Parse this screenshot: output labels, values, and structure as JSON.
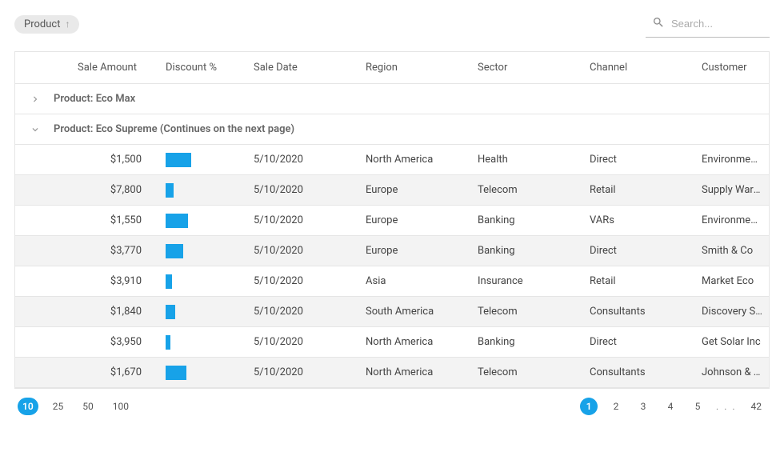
{
  "toolbar": {
    "chip_label": "Product",
    "chip_sort_icon": "arrow-up",
    "search_placeholder": "Search..."
  },
  "columns": [
    "Sale Amount",
    "Discount %",
    "Sale Date",
    "Region",
    "Sector",
    "Channel",
    "Customer"
  ],
  "groups": [
    {
      "expanded": false,
      "label": "Product: Eco Max"
    },
    {
      "expanded": true,
      "label": "Product: Eco Supreme (Continues on the next page)"
    }
  ],
  "rows": [
    {
      "amount": "$1,500",
      "discount_pct": 32,
      "date": "5/10/2020",
      "region": "North America",
      "sector": "Health",
      "channel": "Direct",
      "customer": "Environment Solar"
    },
    {
      "amount": "$7,800",
      "discount_pct": 10,
      "date": "5/10/2020",
      "region": "Europe",
      "sector": "Telecom",
      "channel": "Retail",
      "customer": "Supply Warehous"
    },
    {
      "amount": "$1,550",
      "discount_pct": 28,
      "date": "5/10/2020",
      "region": "Europe",
      "sector": "Banking",
      "channel": "VARs",
      "customer": "Environment Solar"
    },
    {
      "amount": "$3,770",
      "discount_pct": 22,
      "date": "5/10/2020",
      "region": "Europe",
      "sector": "Banking",
      "channel": "Direct",
      "customer": "Smith & Co"
    },
    {
      "amount": "$3,910",
      "discount_pct": 8,
      "date": "5/10/2020",
      "region": "Asia",
      "sector": "Insurance",
      "channel": "Retail",
      "customer": "Market Eco"
    },
    {
      "amount": "$1,840",
      "discount_pct": 12,
      "date": "5/10/2020",
      "region": "South America",
      "sector": "Telecom",
      "channel": "Consultants",
      "customer": "Discovery Systems"
    },
    {
      "amount": "$3,950",
      "discount_pct": 6,
      "date": "5/10/2020",
      "region": "North America",
      "sector": "Banking",
      "channel": "Direct",
      "customer": "Get Solar Inc"
    },
    {
      "amount": "$1,670",
      "discount_pct": 26,
      "date": "5/10/2020",
      "region": "North America",
      "sector": "Telecom",
      "channel": "Consultants",
      "customer": "Johnson & Assoc"
    }
  ],
  "page_sizes": [
    "10",
    "25",
    "50",
    "100"
  ],
  "page_size_active": 0,
  "pages": [
    "1",
    "2",
    "3",
    "4",
    "5"
  ],
  "page_ellipsis": ". . .",
  "page_last": "42",
  "page_active": 0,
  "colors": {
    "accent": "#17a2e8"
  }
}
